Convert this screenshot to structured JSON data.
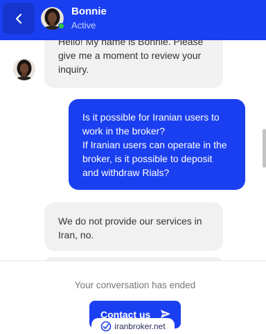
{
  "theme": {
    "brand": "#1a3ff0",
    "online": "#2ecc40"
  },
  "header": {
    "back_icon": "chevron-left-icon",
    "agent_name": "Bonnie",
    "agent_status": "Active"
  },
  "messages": [
    {
      "sender": "agent",
      "text_lines": [
        "Hello! My name is Bonnie. Please",
        "give me a moment to review your",
        "inquiry."
      ]
    },
    {
      "sender": "user",
      "text_lines": [
        "Is it possible for Iranian users to",
        "work in the broker?",
        "If Iranian users can operate in the",
        "broker, is it possible to deposit",
        "and withdraw Rials?"
      ]
    },
    {
      "sender": "agent",
      "text_lines": [
        "We do not provide our services in",
        "Iran, no."
      ]
    }
  ],
  "footer": {
    "ended_text": "Your conversation has ended",
    "contact_label": "Contact us",
    "contact_icon": "send-icon",
    "watermark_text": "iranbroker.net"
  }
}
